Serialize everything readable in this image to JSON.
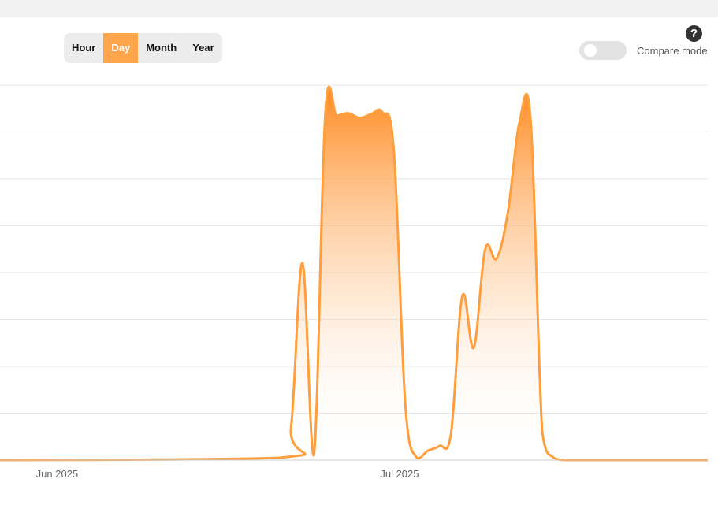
{
  "toolbar": {
    "ranges": [
      {
        "label": "Hour",
        "active": false
      },
      {
        "label": "Day",
        "active": true
      },
      {
        "label": "Month",
        "active": false
      },
      {
        "label": "Year",
        "active": false
      }
    ],
    "help_glyph": "?",
    "compare_label": "Compare mode",
    "compare_enabled": false
  },
  "colors": {
    "accent": "#ffa64d",
    "line": "#ff9e3d",
    "area_top": "#ff8a1f",
    "grid": "#e6e6e6"
  },
  "icons": {
    "help": "question-circle-icon"
  },
  "chart_data": {
    "type": "area",
    "title": "",
    "xlabel": "",
    "ylabel": "",
    "x_tick_labels": [
      "Jun 2025",
      "Jul 2025"
    ],
    "x_tick_days": [
      0,
      30
    ],
    "xlim": [
      -5,
      57
    ],
    "ylim": [
      0,
      8
    ],
    "y_tick_labels_visible": false,
    "grid": true,
    "series": [
      {
        "days": [
          -5,
          19.5,
          20.5,
          21.5,
          22.5,
          23.5,
          24.5,
          25.5,
          26.5,
          27.5,
          28.5,
          29.5,
          30.5,
          31.5,
          32.5,
          33.5,
          34.5,
          35.5,
          36.5,
          37.5,
          38.5,
          39.5,
          40.5,
          41.5,
          42.5,
          43.5,
          44.5,
          45.5,
          46,
          46.5,
          47.5,
          48.5,
          57
        ],
        "values": [
          0,
          0.05,
          0.7,
          4.2,
          0.1,
          7.4,
          7.35,
          7.4,
          7.3,
          7.38,
          7.42,
          6.6,
          1.2,
          0.05,
          0.2,
          0.3,
          0.55,
          3.5,
          2.4,
          4.5,
          4.3,
          5.3,
          7.2,
          7.2,
          0.6,
          0.05,
          0,
          0,
          0,
          0,
          0,
          0,
          0
        ]
      }
    ]
  }
}
